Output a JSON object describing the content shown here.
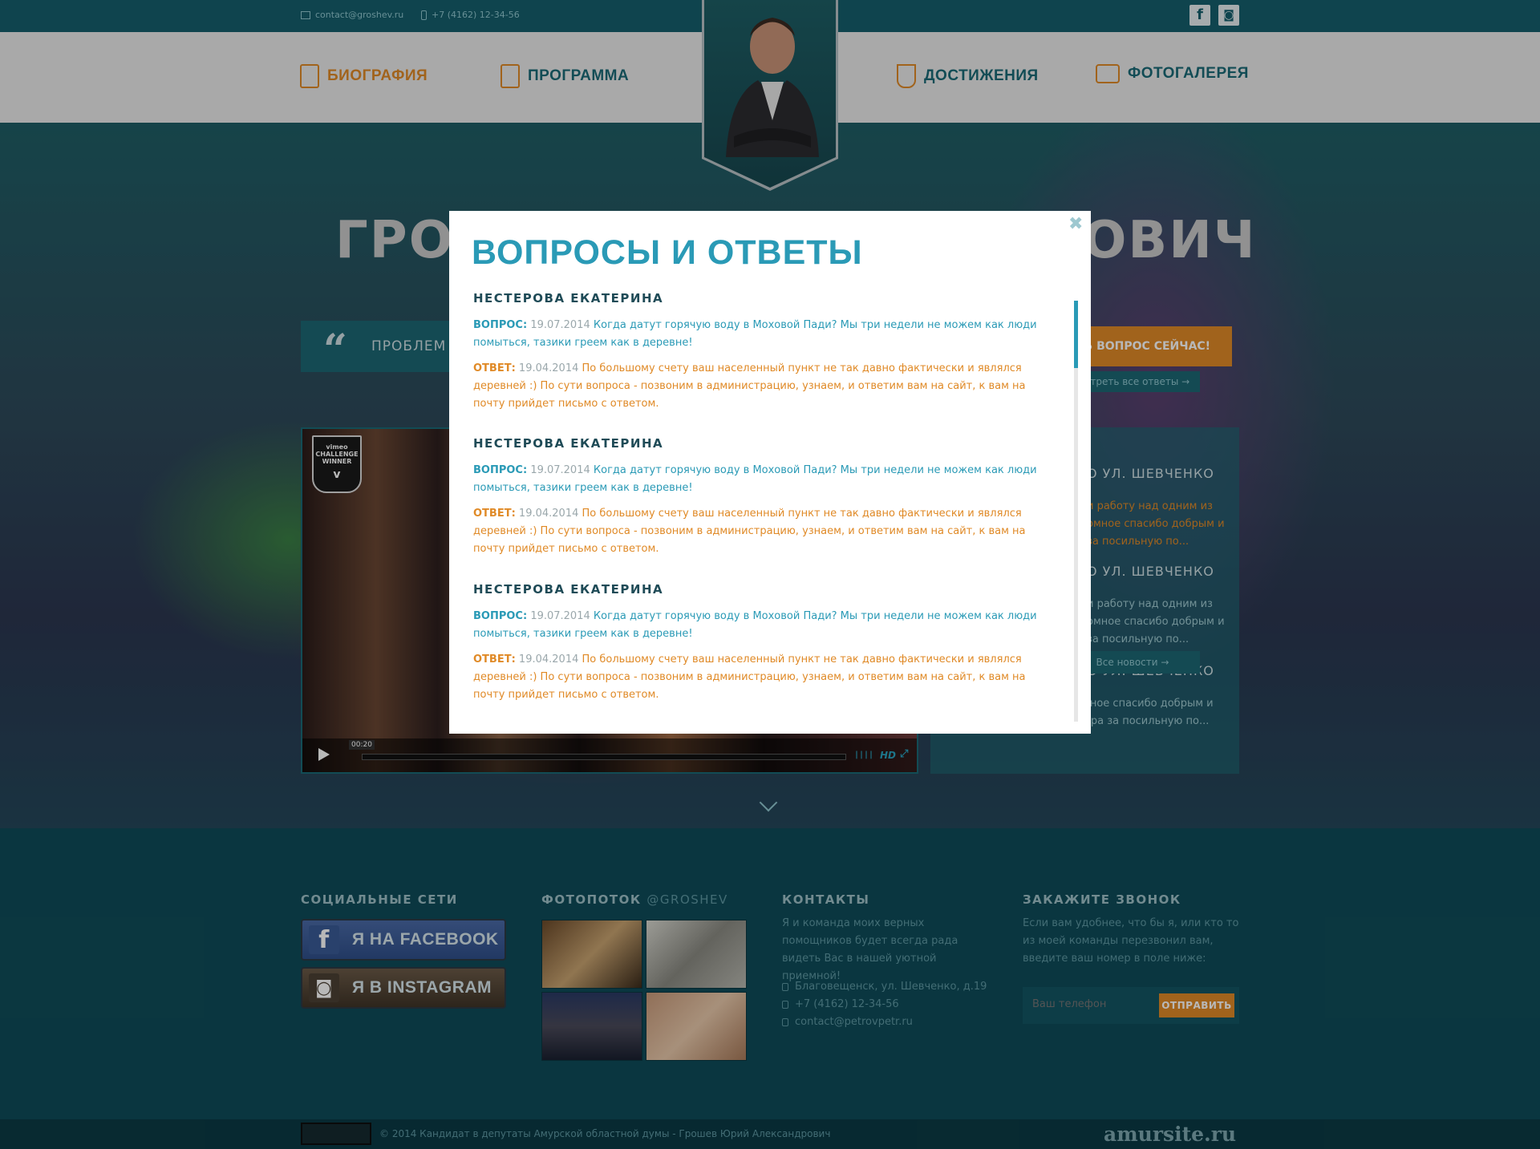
{
  "topbar": {
    "email": "contact@groshev.ru",
    "phone": "+7 (4162) 12-34-56",
    "facebook_icon": "facebook-icon",
    "instagram_icon": "instagram-icon"
  },
  "nav": {
    "biography": "БИОГРАФИЯ",
    "program": "ПРОГРАММА",
    "achievements": "ДОСТИЖЕНИЯ",
    "gallery": "ФОТОГАЛЕРЕЯ"
  },
  "hero": {
    "title_left": "ГРОШ",
    "title_right": "ОВИЧ",
    "quote_text": "ПРОБЛЕМ",
    "ask_button": "ТЬ ВОПРОС СЕЙЧАС!",
    "all_answers": "отреть все ответы →"
  },
  "video": {
    "badge_line1": "vimeo",
    "badge_line2": "CHALLENGE",
    "badge_line3": "WINNER",
    "time": "00:20",
    "hd": "HD",
    "progress": 0
  },
  "news": {
    "items": [
      {
        "title": "О УЛ. ШЕВЧЕНКО",
        "text": "и работу над одним из омное спасибо добрым и за посильную по..."
      },
      {
        "title": "О УЛ. ШЕВЧЕНКО",
        "text": "и работу над одним из омное спасибо добрым и за посильную по..."
      },
      {
        "title": "О УЛ. ШЕВЧЕНКО",
        "text": "и работу над одним из омное спасибо добрым и отзывчивым жильцам двора за посильную по..."
      }
    ],
    "all_news": "Все новости →"
  },
  "footer": {
    "social_heading": "СОЦИАЛЬНЫЕ СЕТИ",
    "facebook_button": "Я НА FACEBOOK",
    "instagram_button": "Я В INSTAGRAM",
    "photostream_heading": "ФОТОПОТОК",
    "photostream_handle": "@GROSHEV",
    "contacts_heading": "КОНТАКТЫ",
    "contacts_text": "Я и команда моих верных помощников будет всегда рада видеть Вас в нашей уютной приемной!",
    "address": "Благовещенск, ул. Шевченко, д.19",
    "phone": "+7 (4162) 12-34-56",
    "email": "contact@petrovpetr.ru",
    "callback_heading": "ЗАКАЖИТЕ ЗВОНОК",
    "callback_text": "Если вам удобнее, что бы я, или кто то из моей команды перезвонил вам, введите ваш номер в поле ниже:",
    "phone_placeholder": "Ваш телефон",
    "send_button": "ОТПРАВИТЬ"
  },
  "bottom": {
    "copyright": "© 2014 Кандидат в депутаты Амурской областной думы - Грошев Юрий Александрович",
    "brand": "amursite.ru"
  },
  "modal": {
    "title": "ВОПРОСЫ И ОТВЕТЫ",
    "close_icon": "close-icon",
    "entries": [
      {
        "name": "НЕСТЕРОВА ЕКАТЕРИНА",
        "q_tag": "ВОПРОС:",
        "q_date": "19.07.2014",
        "q_text": "Когда датут горячую воду в Моховой Пади? Мы три недели не можем как люди помыться, тазики греем как в деревне!",
        "a_tag": "ОТВЕТ:",
        "a_date": "19.04.2014",
        "a_text": "По большому счету ваш населенный пункт не так давно фактически и являлся деревней :) По сути вопроса - позвоним в администрацию, узнаем, и ответим вам на сайт, к вам на почту прийдет письмо с ответом."
      },
      {
        "name": "НЕСТЕРОВА ЕКАТЕРИНА",
        "q_tag": "ВОПРОС:",
        "q_date": "19.07.2014",
        "q_text": "Когда датут горячую воду в Моховой Пади? Мы три недели не можем как люди помыться, тазики греем как в деревне!",
        "a_tag": "ОТВЕТ:",
        "a_date": "19.04.2014",
        "a_text": "По большому счету ваш населенный пункт не так давно фактически и являлся деревней :) По сути вопроса - позвоним в администрацию, узнаем, и ответим вам на сайт, к вам на почту прийдет письмо с ответом."
      },
      {
        "name": "НЕСТЕРОВА ЕКАТЕРИНА",
        "q_tag": "ВОПРОС:",
        "q_date": "19.07.2014",
        "q_text": "Когда датут горячую воду в Моховой Пади? Мы три недели не можем как люди помыться, тазики греем как в деревне!",
        "a_tag": "ОТВЕТ:",
        "a_date": "19.04.2014",
        "a_text": "По большому счету ваш населенный пункт не так давно фактически и являлся деревней :) По сути вопроса - позвоним в администрацию, узнаем, и ответим вам на сайт, к вам на почту прийдет письмо с ответом."
      }
    ]
  },
  "colors": {
    "accent_orange": "#e08a27",
    "accent_teal": "#2a9ab6",
    "dark_teal": "#0f4c59"
  }
}
